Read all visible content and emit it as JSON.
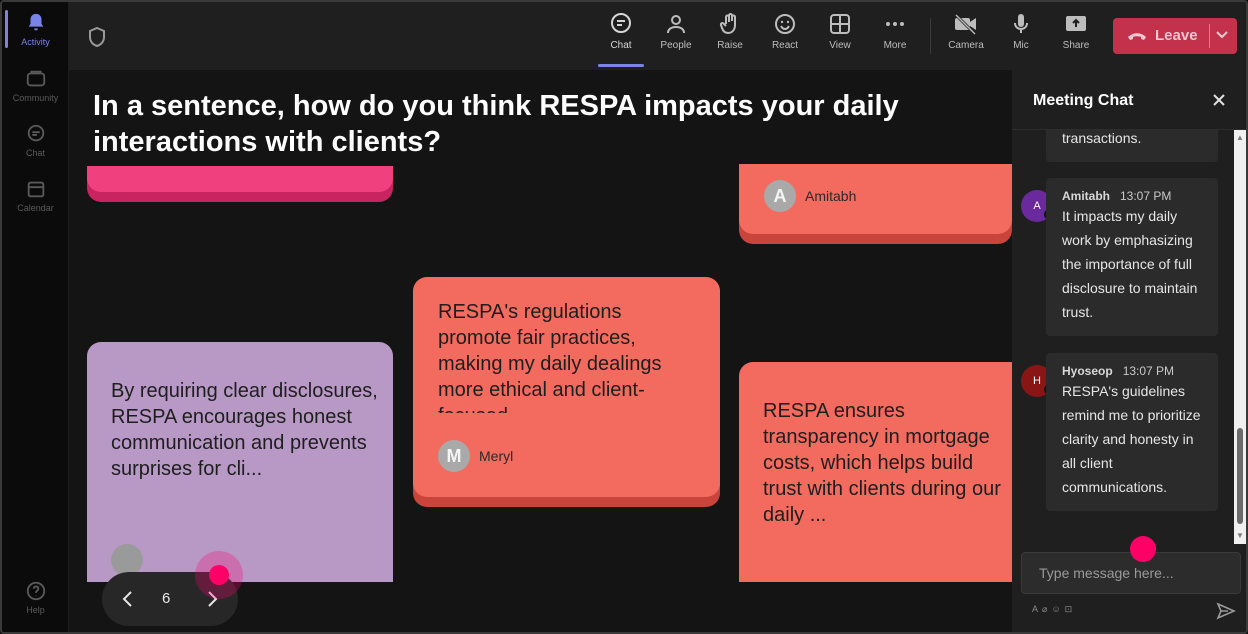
{
  "rail": {
    "items": [
      {
        "label": "Activity",
        "icon": "bell-icon"
      },
      {
        "label": "Community",
        "icon": "community-icon"
      },
      {
        "label": "Chat",
        "icon": "chat-icon"
      },
      {
        "label": "Calendar",
        "icon": "calendar-icon"
      },
      {
        "label": "Help",
        "icon": "help-icon"
      }
    ]
  },
  "toolbar": {
    "chat": "Chat",
    "people": "People",
    "raise": "Raise",
    "react": "React",
    "view": "View",
    "more": "More",
    "camera": "Camera",
    "mic": "Mic",
    "share": "Share",
    "leave": "Leave"
  },
  "stage": {
    "question": "In a sentence, how do you think RESPA impacts your daily interactions with clients?",
    "cards": {
      "amitabh_author": "Amitabh",
      "amitabh_initial": "A",
      "meryl_text": "RESPA's regulations promote fair practices, making my daily dealings more ethical and client-focused",
      "meryl_author": "Meryl",
      "meryl_initial": "M",
      "purple_text": "By requiring clear disclosures, RESPA encourages honest communication and prevents surprises for cli...",
      "salmon_text": "RESPA ensures transparency in mortgage costs, which helps build trust with clients during our daily ..."
    },
    "pager": {
      "page": "6"
    }
  },
  "chat": {
    "title": "Meeting Chat",
    "messages": [
      {
        "text": "transactions."
      },
      {
        "author": "Amitabh",
        "initial": "A",
        "time": "13:07 PM",
        "text": "It impacts my daily work by emphasizing the importance of full disclosure to maintain trust."
      },
      {
        "author": "Hyoseop",
        "initial": "H",
        "time": "13:07 PM",
        "text": "RESPA's guidelines remind me to prioritize clarity and honesty in all client communications."
      }
    ],
    "input_placeholder": "Type message here..."
  },
  "colors": {
    "accent": "#7c83e8",
    "leave": "#c4314b",
    "card_salmon": "#f26b5e",
    "card_purple": "#b899c6",
    "card_pink": "#f0417e",
    "pointer": "#ff0066"
  }
}
